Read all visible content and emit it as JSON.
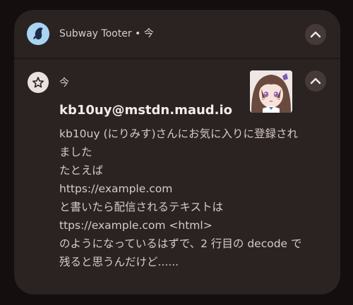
{
  "header": {
    "title": "Subway Tooter • 今",
    "app_icon": "subway-tooter-app-icon",
    "collapse_icon": "chevron-up-icon"
  },
  "notification": {
    "badge_icon": "star-outline-icon",
    "time": "今",
    "avatar_icon": "user-avatar-image",
    "title": "kb10uy@mstdn.maud.io",
    "lines": [
      "kb10uy (にりみす)さんにお気に入りに登録され",
      "ました",
      "たとえば",
      "https://example.com",
      "と書いたら配信されるテキストは",
      "ttps://example.com <html>",
      "のようになっているはずで、2 行目の decode で",
      "残ると思うんだけど......"
    ]
  },
  "colors": {
    "background": "#140f0e",
    "card": "#2b2321",
    "app_icon_bg": "#a9d4f3",
    "button_bg": "#453a38"
  }
}
